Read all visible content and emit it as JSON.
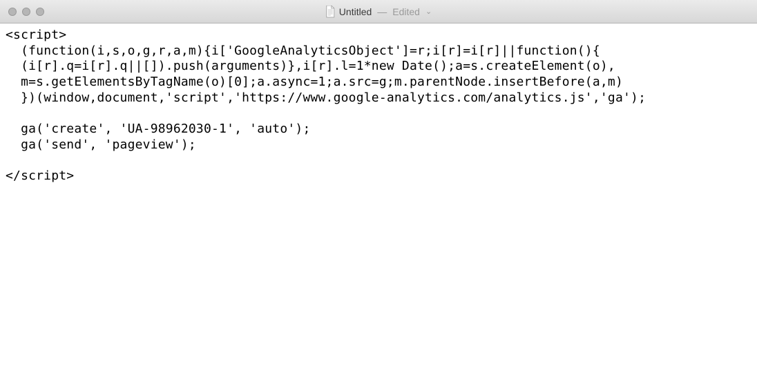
{
  "window": {
    "title_name": "Untitled",
    "title_dash": "—",
    "title_edited": "Edited"
  },
  "editor": {
    "content": "<script>\n  (function(i,s,o,g,r,a,m){i['GoogleAnalyticsObject']=r;i[r]=i[r]||function(){\n  (i[r].q=i[r].q||[]).push(arguments)},i[r].l=1*new Date();a=s.createElement(o),\n  m=s.getElementsByTagName(o)[0];a.async=1;a.src=g;m.parentNode.insertBefore(a,m)\n  })(window,document,'script','https://www.google-analytics.com/analytics.js','ga');\n\n  ga('create', 'UA-98962030-1', 'auto');\n  ga('send', 'pageview');\n\n</script>"
  }
}
